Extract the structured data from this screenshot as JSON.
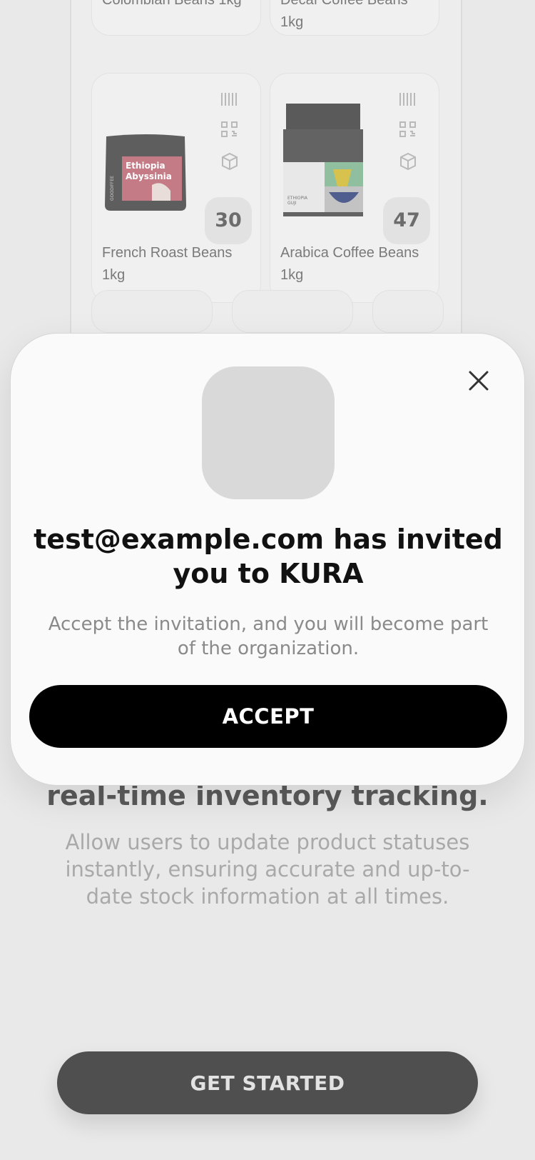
{
  "products": [
    {
      "name": "Colombian Beans 1kg"
    },
    {
      "name": "Decaf Coffee Beans 1kg"
    },
    {
      "name": "French Roast Beans 1kg",
      "count": "30",
      "bag_label": "Ethiopia Abyssinia",
      "bag_brand": "GOODIFFEE"
    },
    {
      "name": "Arabica Coffee Beans 1kg",
      "count": "47",
      "bag_label": "ETHIOPIA GUJI"
    }
  ],
  "card_icons": [
    "barcode-icon",
    "qr-code-icon",
    "package-icon"
  ],
  "background": {
    "heading": "real-time  inventory tracking.",
    "description": "Allow users to update product statuses instantly, ensuring accurate and up-to-date stock information at all times.",
    "cta_label": "GET STARTED"
  },
  "modal": {
    "title": "test@example.com has invited you to KURA",
    "description": "Accept the invitation, and you will become part of the organization.",
    "accept_label": "ACCEPT",
    "close_icon": "close-icon"
  },
  "colors": {
    "background": "#e9e9e9",
    "modal": "#fafafa",
    "accept_button": "#000000",
    "get_started_button": "#4f4f4f",
    "avatar_placeholder": "#d9d9d9"
  }
}
